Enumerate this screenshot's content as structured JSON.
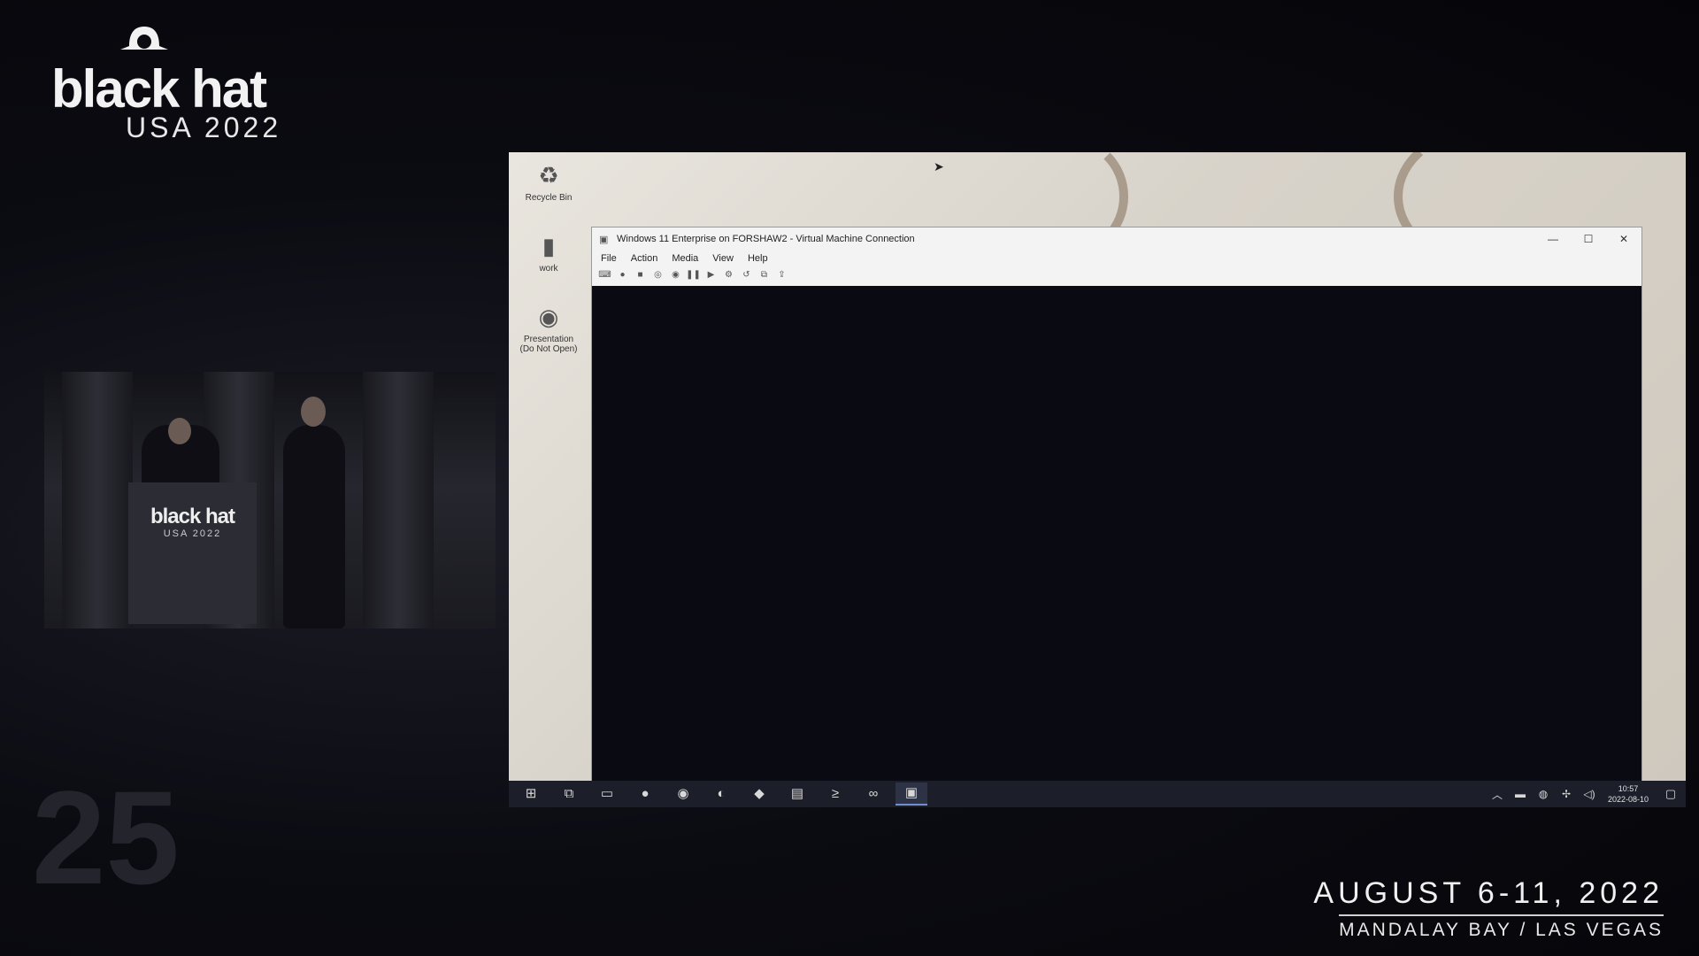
{
  "branding": {
    "name": "black hat",
    "edition": "USA 2022",
    "dates": "AUGUST 6-11, 2022",
    "location": "MANDALAY BAY / LAS VEGAS",
    "anniversary_mark": "25"
  },
  "stage": {
    "podium_name": "black hat",
    "podium_edition": "USA 2022"
  },
  "desktop": {
    "icons": [
      {
        "label": "Recycle Bin",
        "icon": "recycle-bin-icon"
      },
      {
        "label": "work",
        "icon": "folder-icon"
      },
      {
        "label": "Presentation (Do Not Open)",
        "icon": "chrome-icon"
      }
    ]
  },
  "vm_window": {
    "title": "Windows 11 Enterprise on FORSHAW2 - Virtual Machine Connection",
    "menu": [
      "File",
      "Action",
      "Media",
      "View",
      "Help"
    ],
    "toolbar": [
      "ctrl-alt-del-icon",
      "start-icon",
      "turn-off-icon",
      "shutdown-icon",
      "save-icon",
      "pause-icon",
      "resume-icon",
      "checkpoint-icon",
      "revert-icon",
      "enhanced-session-icon",
      "share-icon"
    ]
  },
  "taskbar": {
    "icons": [
      "start-icon",
      "task-view-icon",
      "file-explorer-icon",
      "chrome-icon",
      "chrome-alt-icon",
      "edge-icon",
      "git-icon",
      "package-icon",
      "terminal-icon",
      "visual-studio-icon",
      "hyper-v-icon"
    ],
    "tray": [
      "chevron-up-icon",
      "network-icon",
      "globe-icon",
      "wifi-icon",
      "volume-icon"
    ],
    "time": "10:57",
    "date": "2022-08-10"
  },
  "colors": {
    "background": "#08080d",
    "vm_display": "#090a12",
    "taskbar": "#1c1f2a",
    "accent": "#6f8fd0"
  }
}
